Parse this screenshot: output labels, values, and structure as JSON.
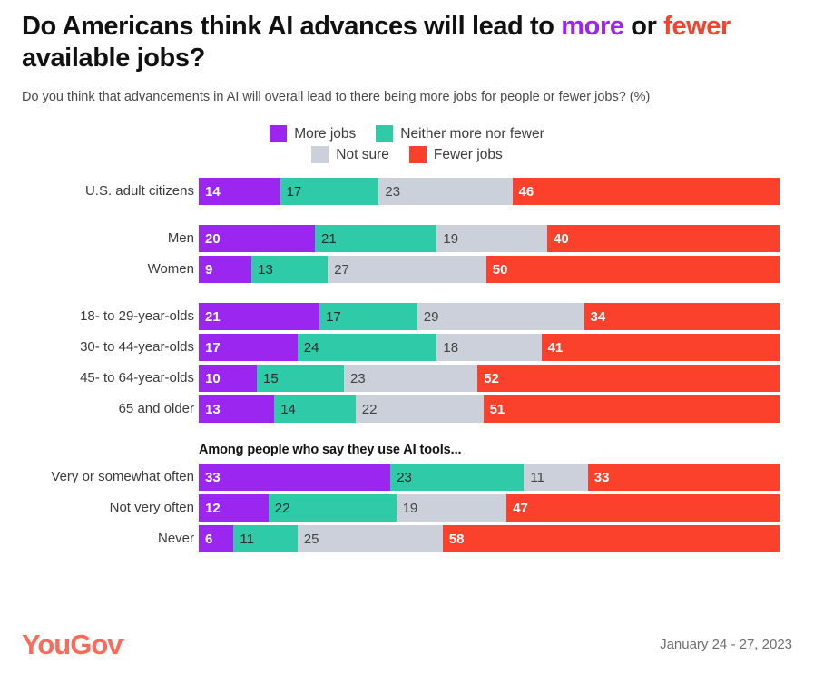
{
  "title": {
    "part1": "Do Americans think AI advances will lead to ",
    "more": "more",
    "part2": " or ",
    "fewer": "fewer",
    "part3": " available jobs?"
  },
  "subtitle": "Do you think that advancements in AI will overall lead to there being more jobs for people or fewer jobs? (%)",
  "legend": {
    "row1": [
      {
        "label": "More jobs",
        "color": "#9b26f0"
      },
      {
        "label": "Neither more nor fewer",
        "color": "#2fcaa8"
      }
    ],
    "row2": [
      {
        "label": "Not sure",
        "color": "#ccd0da"
      },
      {
        "label": "Fewer jobs",
        "color": "#fb402b"
      }
    ]
  },
  "groups": [
    {
      "heading": "",
      "rows": [
        {
          "label": "U.S. adult citizens",
          "values": [
            14,
            17,
            23,
            46
          ]
        }
      ]
    },
    {
      "heading": "",
      "rows": [
        {
          "label": "Men",
          "values": [
            20,
            21,
            19,
            40
          ]
        },
        {
          "label": "Women",
          "values": [
            9,
            13,
            27,
            50
          ]
        }
      ]
    },
    {
      "heading": "",
      "rows": [
        {
          "label": "18- to 29-year-olds",
          "values": [
            21,
            17,
            29,
            34
          ]
        },
        {
          "label": "30- to 44-year-olds",
          "values": [
            17,
            24,
            18,
            41
          ]
        },
        {
          "label": "45- to 64-year-olds",
          "values": [
            10,
            15,
            23,
            52
          ]
        },
        {
          "label": "65 and older",
          "values": [
            13,
            14,
            22,
            51
          ]
        }
      ]
    },
    {
      "heading": "Among people who say they use AI tools...",
      "rows": [
        {
          "label": "Very or somewhat often",
          "values": [
            33,
            23,
            11,
            33
          ]
        },
        {
          "label": "Not very often",
          "values": [
            12,
            22,
            19,
            47
          ]
        },
        {
          "label": "Never",
          "values": [
            6,
            11,
            25,
            58
          ]
        }
      ]
    }
  ],
  "footer": {
    "logo": "YouGov",
    "logo_mark": "·",
    "date": "January 24 - 27, 2023"
  },
  "chart_data": {
    "type": "bar",
    "orientation": "horizontal",
    "stacked": true,
    "normalized_to_percent": true,
    "title": "Do Americans think AI advances will lead to more or fewer available jobs?",
    "subtitle": "Do you think that advancements in AI will overall lead to there being more jobs for people or fewer jobs? (%)",
    "xlabel": "",
    "ylabel": "",
    "xlim": [
      0,
      100
    ],
    "grid": false,
    "legend_position": "top-center",
    "categories": [
      "U.S. adult citizens",
      "Men",
      "Women",
      "18- to 29-year-olds",
      "30- to 44-year-olds",
      "45- to 64-year-olds",
      "65 and older",
      "Very or somewhat often",
      "Not very often",
      "Never"
    ],
    "series": [
      {
        "name": "More jobs",
        "color": "#9b26f0",
        "values": [
          14,
          20,
          9,
          21,
          17,
          10,
          13,
          33,
          12,
          6
        ]
      },
      {
        "name": "Neither more nor fewer",
        "color": "#2fcaa8",
        "values": [
          17,
          21,
          13,
          17,
          24,
          15,
          14,
          23,
          22,
          11
        ]
      },
      {
        "name": "Not sure",
        "color": "#ccd0da",
        "values": [
          23,
          19,
          27,
          29,
          18,
          23,
          22,
          11,
          19,
          25
        ]
      },
      {
        "name": "Fewer jobs",
        "color": "#fb402b",
        "values": [
          46,
          40,
          50,
          34,
          41,
          52,
          51,
          33,
          47,
          58
        ]
      }
    ],
    "annotations": [
      {
        "text": "Among people who say they use AI tools...",
        "applies_to": [
          "Very or somewhat often",
          "Not very often",
          "Never"
        ]
      }
    ],
    "source_date": "January 24 - 27, 2023",
    "source": "YouGov"
  }
}
